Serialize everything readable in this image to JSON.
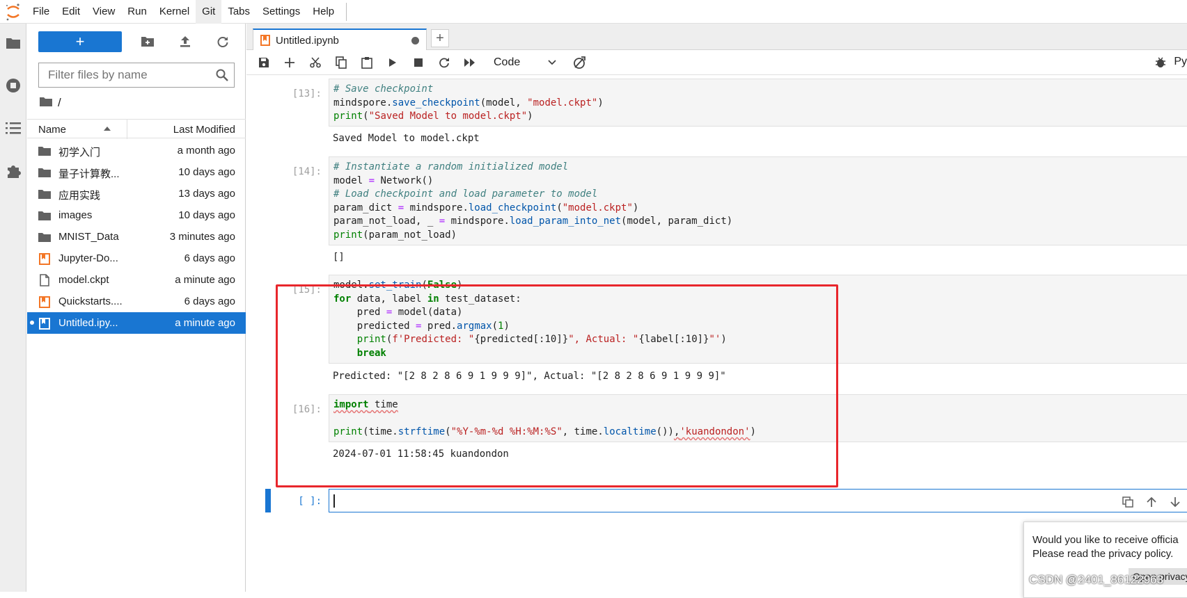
{
  "menubar": {
    "items": [
      "File",
      "Edit",
      "View",
      "Run",
      "Kernel",
      "Git",
      "Tabs",
      "Settings",
      "Help"
    ],
    "active_index": 5
  },
  "filebrowser": {
    "new_button_label": "+",
    "filter_placeholder": "Filter files by name",
    "breadcrumb": "/",
    "col_name": "Name",
    "col_modified": "Last Modified",
    "files": [
      {
        "name": "初学入门",
        "modified": "a month ago",
        "icon": "folder-icon"
      },
      {
        "name": "量子计算教...",
        "modified": "10 days ago",
        "icon": "folder-icon"
      },
      {
        "name": "应用实践",
        "modified": "13 days ago",
        "icon": "folder-icon"
      },
      {
        "name": "images",
        "modified": "10 days ago",
        "icon": "folder-icon"
      },
      {
        "name": "MNIST_Data",
        "modified": "3 minutes ago",
        "icon": "folder-icon"
      },
      {
        "name": "Jupyter-Do...",
        "modified": "6 days ago",
        "icon": "notebook-icon"
      },
      {
        "name": "model.ckpt",
        "modified": "a minute ago",
        "icon": "file-icon"
      },
      {
        "name": "Quickstarts....",
        "modified": "6 days ago",
        "icon": "notebook-icon"
      },
      {
        "name": "Untitled.ipy...",
        "modified": "a minute ago",
        "icon": "notebook-icon",
        "selected": true
      }
    ]
  },
  "tab": {
    "title": "Untitled.ipynb",
    "add_label": "+"
  },
  "toolbar": {
    "cell_type": "Code",
    "kernel_name": "Py"
  },
  "cells": [
    {
      "prompt": "[13]:",
      "code": [
        "# Save checkpoint",
        "mindspore.save_checkpoint(model, \"model.ckpt\")",
        "print(\"Saved Model to model.ckpt\")"
      ],
      "output": "Saved Model to model.ckpt"
    },
    {
      "prompt": "[14]:",
      "code": [
        "# Instantiate a random initialized model",
        "model = Network()",
        "# Load checkpoint and load parameter to model",
        "param_dict = mindspore.load_checkpoint(\"model.ckpt\")",
        "param_not_load, _ = mindspore.load_param_into_net(model, param_dict)",
        "print(param_not_load)"
      ],
      "output": "[]"
    },
    {
      "prompt": "[15]:",
      "code": [
        "model.set_train(False)",
        "for data, label in test_dataset:",
        "    pred = model(data)",
        "    predicted = pred.argmax(1)",
        "    print(f'Predicted: \"{predicted[:10]}\", Actual: \"{label[:10]}\"')",
        "    break"
      ],
      "output": "Predicted: \"[2 8 2 8 6 9 1 9 9 9]\", Actual: \"[2 8 2 8 6 9 1 9 9 9]\""
    },
    {
      "prompt": "[16]:",
      "code": [
        "import time",
        "",
        "print(time.strftime(\"%Y-%m-%d %H:%M:%S\", time.localtime()),'kuandondon')"
      ],
      "output": "2024-07-01 11:58:45 kuandondon"
    }
  ],
  "active_cell": {
    "prompt": "[ ]:"
  },
  "notification": {
    "line1": "Would you like to receive officia",
    "line2": "Please read the privacy policy.",
    "button": "Open privacy"
  },
  "watermark": "CSDN @2401_86122963",
  "colors": {
    "accent": "#1976d2",
    "highlight_box": "#e8262c",
    "notebook_icon": "#f37626"
  }
}
